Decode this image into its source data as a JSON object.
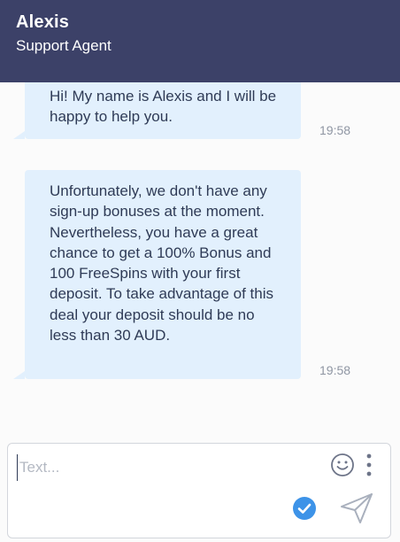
{
  "header": {
    "agent_name": "Alexis",
    "agent_role": "Support Agent",
    "background_color": "#3c4168"
  },
  "messages": [
    {
      "sender": "agent",
      "text": "Hi! My name is Alexis and I will be happy to help you.",
      "time": "19:58"
    },
    {
      "sender": "agent",
      "text": "Unfortunately, we don't have any sign-up bonuses at the moment. Nevertheless, you have a great chance to get a 100% Bonus and 100 FreeSpins with your first deposit. To take advantage of this deal your deposit should be no less than 30 AUD.",
      "time": "19:58"
    }
  ],
  "composer": {
    "placeholder": "Text...",
    "value": "",
    "icons": {
      "emoji": "emoji-smiley-icon",
      "more": "vertical-dots-icon",
      "check": "checkmark-circle-icon",
      "send": "paper-plane-send-icon"
    },
    "check_color": "#3d93e8"
  },
  "colors": {
    "bubble": "#e2f0fd",
    "time": "#8f96a3"
  }
}
